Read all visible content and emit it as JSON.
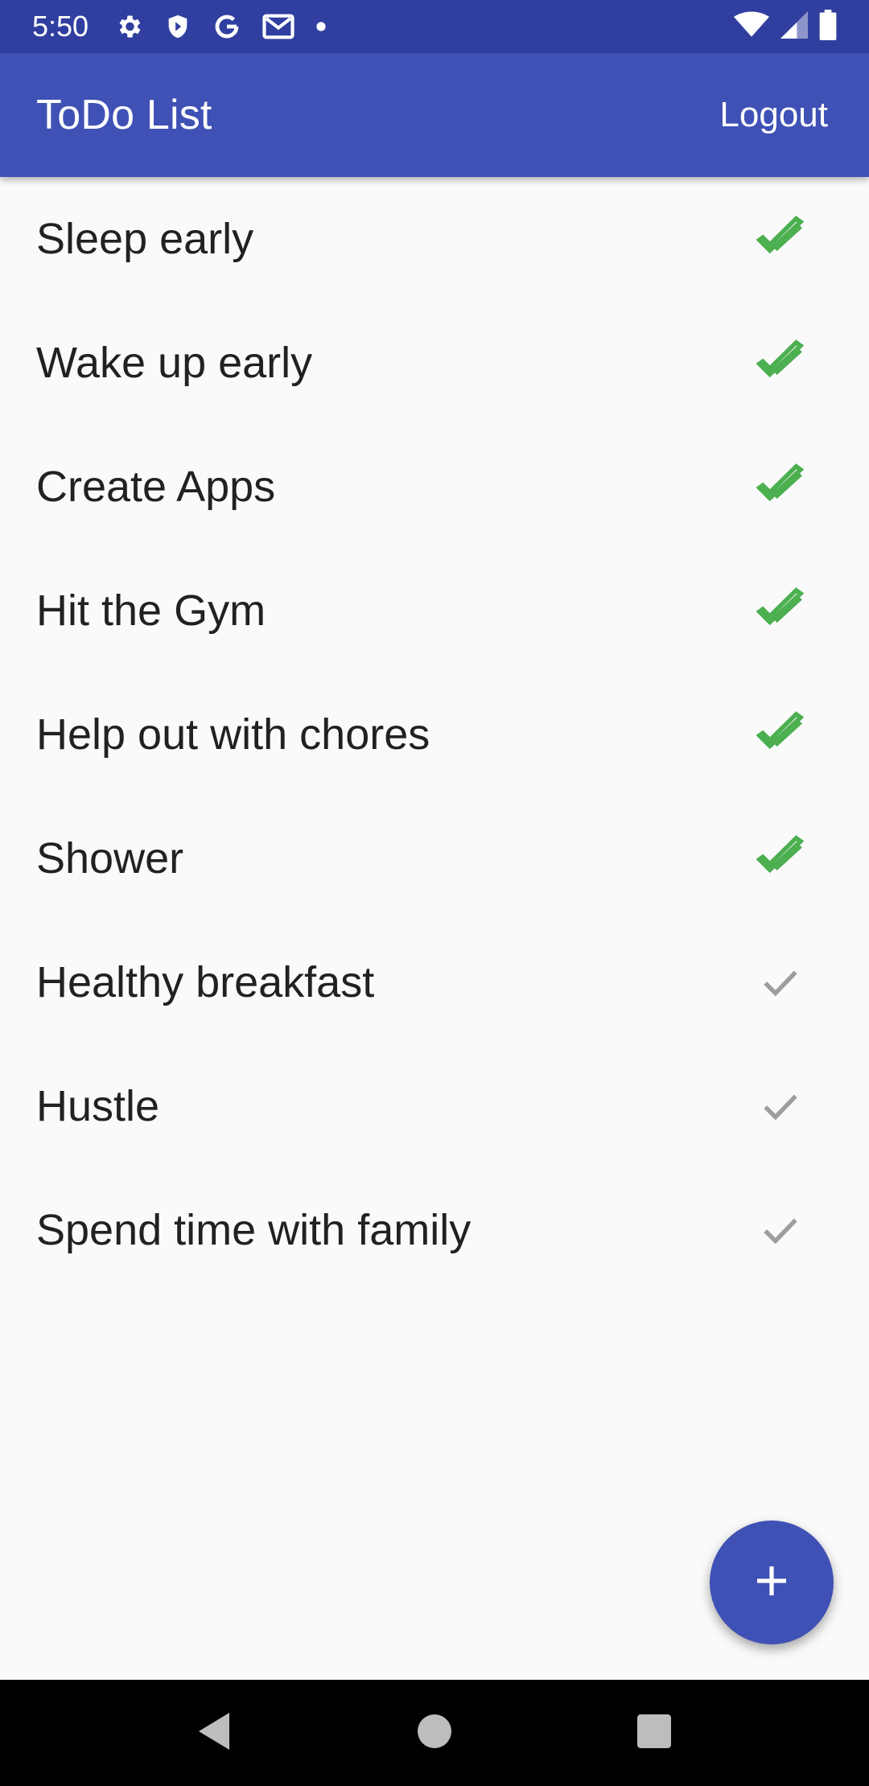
{
  "status_bar": {
    "time": "5:50",
    "left_icons": [
      "gear-icon",
      "shield-icon",
      "google-icon",
      "gmail-icon",
      "dot-icon"
    ],
    "right_icons": [
      "wifi-icon",
      "signal-icon",
      "battery-icon"
    ]
  },
  "app_bar": {
    "title": "ToDo List",
    "logout_label": "Logout"
  },
  "todos": [
    {
      "label": "Sleep early",
      "done": true
    },
    {
      "label": "Wake up early",
      "done": true
    },
    {
      "label": "Create Apps",
      "done": true
    },
    {
      "label": "Hit the Gym",
      "done": true
    },
    {
      "label": "Help out with chores",
      "done": true
    },
    {
      "label": "Shower",
      "done": true
    },
    {
      "label": "Healthy breakfast",
      "done": false
    },
    {
      "label": "Hustle",
      "done": false
    },
    {
      "label": "Spend time with family",
      "done": false
    }
  ],
  "fab": {
    "icon": "plus-icon"
  },
  "nav_bar": {
    "icons": [
      "back-icon",
      "home-icon",
      "recents-icon"
    ]
  },
  "colors": {
    "primary": "#3f51b5",
    "primary_dark": "#303f9f",
    "done_check": "#4caf50",
    "pending_check": "#9e9e9e"
  }
}
